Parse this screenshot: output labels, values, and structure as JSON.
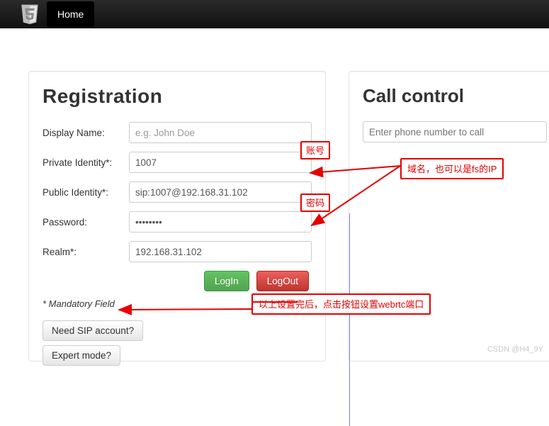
{
  "nav": {
    "home": "Home"
  },
  "registration": {
    "title": "Registration",
    "displayName_label": "Display Name:",
    "displayName_placeholder": "e.g. John Doe",
    "displayName_value": "",
    "privateIdentity_label": "Private Identity*:",
    "privateIdentity_value": "1007",
    "publicIdentity_label": "Public Identity*:",
    "publicIdentity_value": "sip:1007@192.168.31.102",
    "password_label": "Password:",
    "password_value": "••••••••",
    "realm_label": "Realm*:",
    "realm_value": "192.168.31.102",
    "login": "LogIn",
    "logout": "LogOut",
    "mandatory": "* Mandatory Field",
    "needSip": "Need SIP account?",
    "expert": "Expert mode?"
  },
  "call": {
    "title": "Call control",
    "phone_placeholder": "Enter phone number to call",
    "phone_value": ""
  },
  "annotations": {
    "account": "账号",
    "password": "密码",
    "domain": "域名，也可以是fs的IP",
    "bottom": "以上设置完后，点击按钮设置webrtc端口"
  },
  "watermark": "CSDN @H4_9Y"
}
